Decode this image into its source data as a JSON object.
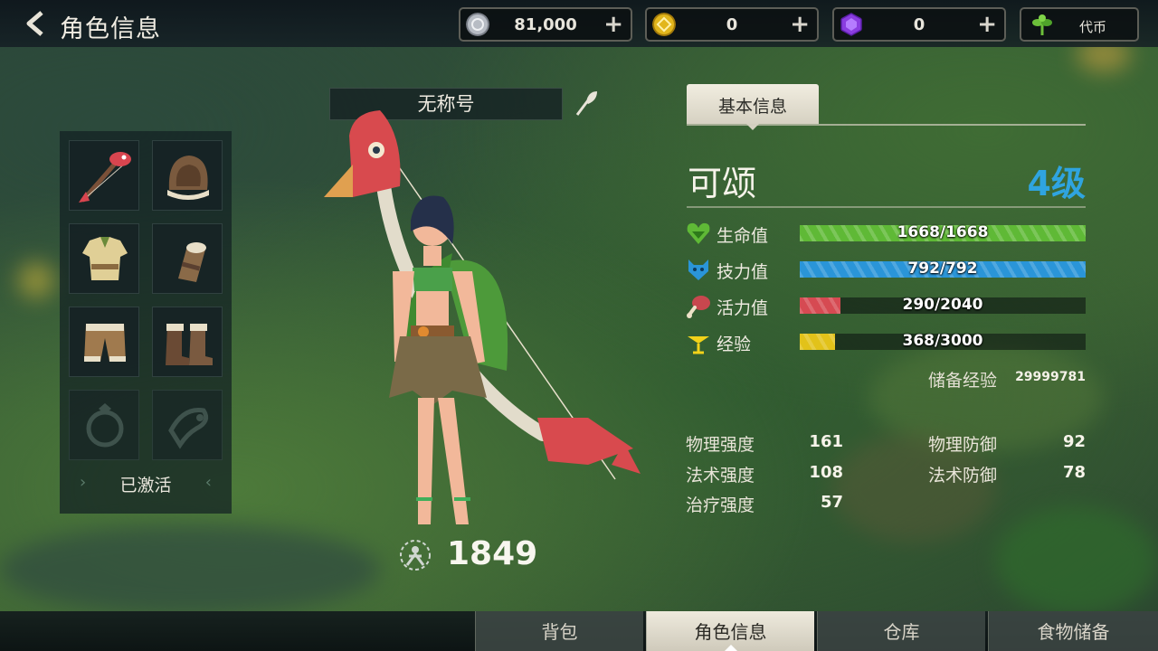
{
  "header": {
    "title": "角色信息",
    "currencies": [
      {
        "icon": "silver-coin-icon",
        "value": "81,000"
      },
      {
        "icon": "gold-coin-icon",
        "value": "0"
      },
      {
        "icon": "purple-gem-icon",
        "value": "0"
      }
    ],
    "token": {
      "icon": "sprout-icon",
      "label": "代币"
    }
  },
  "equipment": {
    "slots": [
      {
        "icon": "fish-bow-icon",
        "empty": false
      },
      {
        "icon": "fur-hood-icon",
        "empty": false
      },
      {
        "icon": "tunic-icon",
        "empty": false
      },
      {
        "icon": "bracer-icon",
        "empty": false
      },
      {
        "icon": "pants-icon",
        "empty": false
      },
      {
        "icon": "boots-icon",
        "empty": false
      },
      {
        "icon": "ring-icon",
        "empty": true
      },
      {
        "icon": "accessory-icon",
        "empty": true
      }
    ],
    "status_label": "已激活"
  },
  "character": {
    "title": "无称号",
    "power": "1849"
  },
  "info": {
    "tab_label": "基本信息",
    "name": "可颂",
    "level": "4级",
    "bars": [
      {
        "icon": "heart-icon",
        "label": "生命值",
        "text": "1668/1668",
        "fraction": 1.0,
        "color": "#5fb936"
      },
      {
        "icon": "wolf-head-icon",
        "label": "技力值",
        "text": "792/792",
        "fraction": 1.0,
        "color": "#2a95d8"
      },
      {
        "icon": "meat-icon",
        "label": "活力值",
        "text": "290/2040",
        "fraction": 0.142,
        "color": "#d64a52"
      },
      {
        "icon": "exp-icon",
        "label": "经验",
        "text": "368/3000",
        "fraction": 0.123,
        "color": "#e2c21a"
      }
    ],
    "reserve_exp_label": "储备经验",
    "reserve_exp_value": "29999781",
    "stats": [
      {
        "label": "物理强度",
        "value": "161"
      },
      {
        "label": "物理防御",
        "value": "92"
      },
      {
        "label": "法术强度",
        "value": "108"
      },
      {
        "label": "法术防御",
        "value": "78"
      },
      {
        "label": "治疗强度",
        "value": "57"
      }
    ]
  },
  "nav": {
    "tabs": [
      "背包",
      "角色信息",
      "仓库",
      "食物储备"
    ],
    "active_index": 1
  }
}
